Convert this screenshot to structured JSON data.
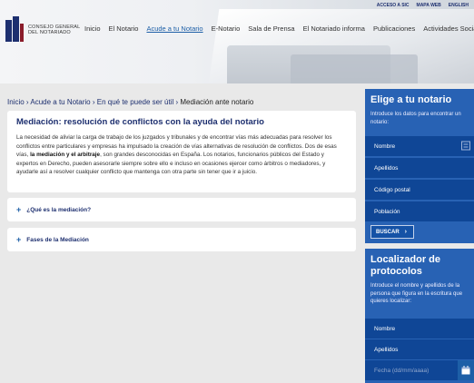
{
  "header": {
    "logo_line1": "CONSEJO GENERAL",
    "logo_line2": "DEL NOTARIADO",
    "top_links": [
      "ACCESO A SIC",
      "MAPA WEB",
      "ENGLISH"
    ],
    "nav": [
      "Inicio",
      "El Notario",
      "Acude a tu Notario",
      "E-Notario",
      "Sala de Prensa",
      "El Notariado informa",
      "Publicaciones",
      "Actividades Sociales"
    ],
    "active_nav_index": 2
  },
  "breadcrumb": {
    "items": [
      "Inicio",
      "Acude a tu Notario",
      "En qué te puede ser útil",
      "Mediación ante notario"
    ],
    "separator": " › "
  },
  "article": {
    "title": "Mediación: resolución de conflictos con la ayuda del notario",
    "p1": "La necesidad de aliviar la carga de trabajo de los juzgados y tribunales y de encontrar vías más adecuadas para resolver los conflictos entre particulares y empresas ha impulsado la creación de vías alternativas de resolución de conflictos. Dos de esas vías, ",
    "b1": "la mediación y el arbitraje",
    "p2": ", son grandes desconocidas en España. Los notarios, funcionarios públicos del Estado y expertos en Derecho, pueden asesorarle siempre sobre ello e incluso en ocasiones ejercer como árbitros o mediadores, y ayudarle así  a resolver cualquier conflicto que mantenga con otra parte sin tener que ir a juicio."
  },
  "accordion": [
    {
      "label": "¿Qué es la mediación?"
    },
    {
      "label": "Fases de la Mediación"
    }
  ],
  "finder": {
    "title": "Elige a tu notario",
    "intro": "Introduce los datos para encontrar un notario:",
    "fields": [
      "Nombre",
      "Apellidos",
      "Código postal",
      "Población"
    ],
    "button": "BUSCAR"
  },
  "locator": {
    "title": "Localizador de protocolos",
    "intro": "Introduce el nombre y apellidos de la persona que figura en la escritura que quieres localizar:",
    "fields": [
      "Nombre",
      "Apellidos"
    ],
    "date_placeholder": "Fecha (dd/mm/aaaa)"
  },
  "colors": {
    "brand": "#1d2f6f",
    "panel": "#2862b4",
    "field": "#0f4696",
    "link": "#1d5fa7"
  },
  "icons": [
    "list-icon",
    "calendar-icon",
    "plus-icon",
    "arrow-right-icon"
  ]
}
